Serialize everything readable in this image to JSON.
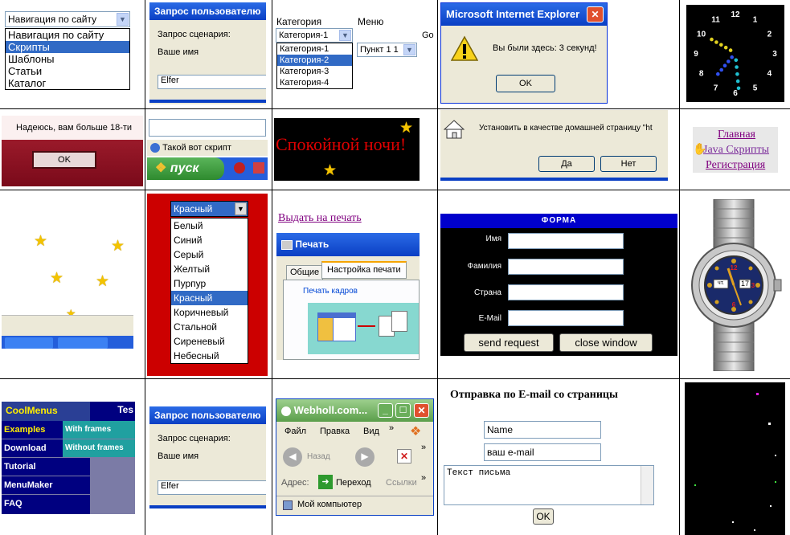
{
  "c1": {
    "select": "Навигация по сайту",
    "options": [
      "Навигация по сайту",
      "Скрипты",
      "Шаблоны",
      "Статьи",
      "Каталог"
    ],
    "selected_index": 1
  },
  "c2": {
    "title": "Запрос пользователю",
    "prompt": "Запрос сценария:",
    "label": "Ваше имя",
    "value": "Elfer"
  },
  "c3": {
    "cat_label": "Категория",
    "menu_label": "Меню",
    "cat_select": "Категория-1",
    "menu_select": "Пункт 1 1",
    "go": "Go",
    "options": [
      "Категория-1",
      "Категория-2",
      "Категория-3",
      "Категория-4"
    ],
    "selected_index": 1
  },
  "c4": {
    "title": "Microsoft Internet Explorer",
    "message": "Вы были здесь: 3 секунд!",
    "ok": "OK"
  },
  "c5": {
    "numbers": [
      "12",
      "1",
      "2",
      "3",
      "4",
      "5",
      "6",
      "7",
      "8",
      "9",
      "10",
      "11"
    ]
  },
  "c6": {
    "message": "Надеюсь, вам больше 18-ти",
    "ok": "OK"
  },
  "c7": {
    "script_label": "Такой вот скрипт",
    "start": "пуск"
  },
  "c8": {
    "text": "Спокойной ночи!"
  },
  "c9": {
    "message": "Установить в качестве домашней страницу \"ht",
    "yes": "Да",
    "no": "Нет"
  },
  "c10": {
    "links": [
      "Главная",
      "Java Скрипты",
      "Регистрация"
    ]
  },
  "c12": {
    "select": "Красный",
    "options": [
      "Белый",
      "Синий",
      "Серый",
      "Желтый",
      "Пурпур",
      "Красный",
      "Коричневый",
      "Стальной",
      "Сиреневый",
      "Небесный"
    ],
    "selected_index": 5
  },
  "c13": {
    "print_link": "Выдать на печать",
    "title": "Печать",
    "tab_general": "Общие",
    "tab_settings": "Настройка печати",
    "group": "Печать кадров"
  },
  "c14": {
    "title": "ФОРМА",
    "fields": [
      "Имя",
      "Фамилия",
      "Страна",
      "E-Mail"
    ],
    "send": "send request",
    "close": "close window"
  },
  "c15": {
    "day": "чт.",
    "date": "17"
  },
  "c16": {
    "logo": "CoolMenus",
    "tes": "Tes",
    "items": [
      "Examples",
      "Download",
      "Tutorial",
      "MenuMaker",
      "FAQ"
    ],
    "sub": [
      "With frames",
      "Without frames"
    ]
  },
  "c17": {
    "title": "Запрос пользователю",
    "prompt": "Запрос сценария:",
    "label": "Ваше имя",
    "value": "Elfer"
  },
  "c18": {
    "title": "Webholl.com...",
    "menu": [
      "Файл",
      "Правка",
      "Вид"
    ],
    "back": "Назад",
    "address": "Адрес:",
    "go": "Переход",
    "links": "Ссылки",
    "status": "Мой компьютер"
  },
  "c19": {
    "heading": "Отправка по E-mail со страницы",
    "name": "Name",
    "email": "ваш e-mail",
    "body": "Текст письма",
    "ok": "OK"
  },
  "colors": {
    "xp_blue": "#0a3fc4",
    "highlight": "#316ac5",
    "red": "#cc0000",
    "night": "#000000"
  }
}
